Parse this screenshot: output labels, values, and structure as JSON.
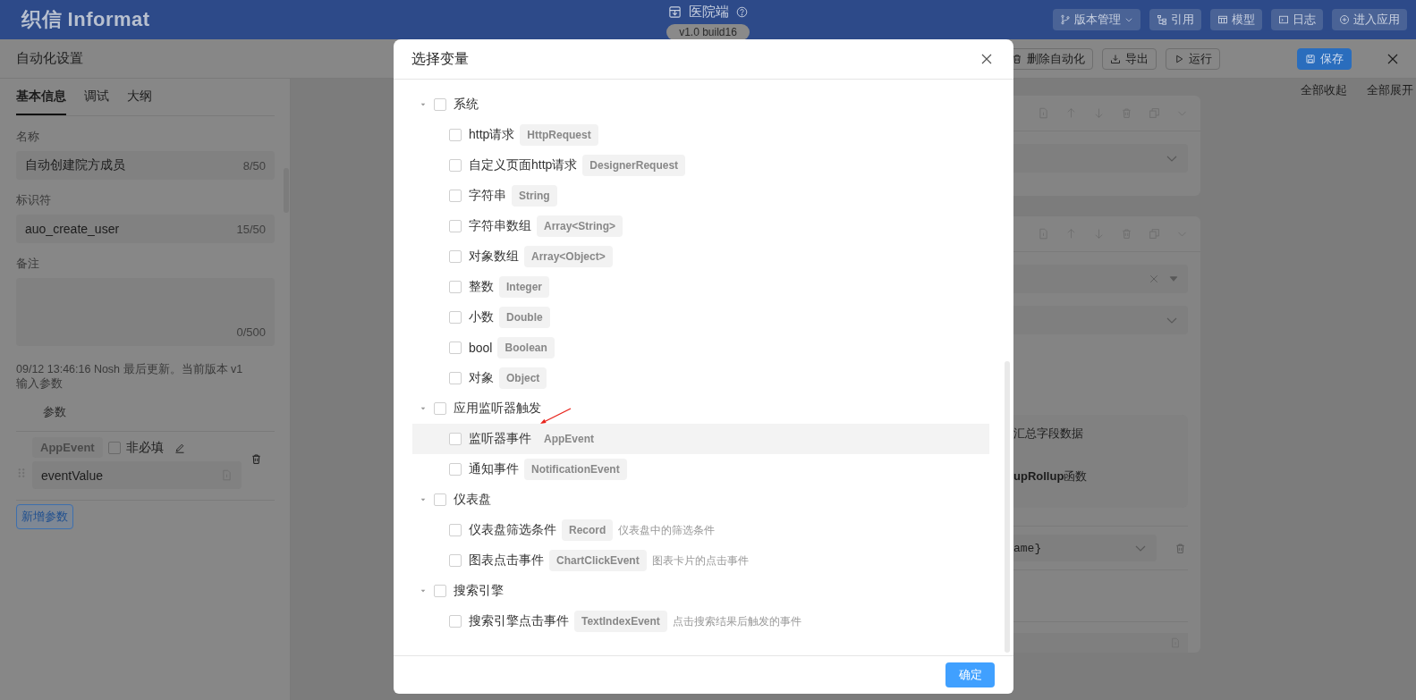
{
  "header": {
    "logo": "织信 Informat",
    "app_title": "医院端",
    "version": "v1.0 build16",
    "buttons": [
      {
        "label": "版本管理",
        "dropdown": true
      },
      {
        "label": "引用",
        "dropdown": false
      },
      {
        "label": "模型",
        "dropdown": false
      },
      {
        "label": "日志",
        "dropdown": false
      },
      {
        "label": "进入应用",
        "dropdown": false
      }
    ]
  },
  "drawer": {
    "title": "自动化设置",
    "actions": [
      {
        "label": "删除自动化",
        "primary": false
      },
      {
        "label": "导出",
        "primary": false
      },
      {
        "label": "运行",
        "primary": false
      },
      {
        "label": "保存",
        "primary": true
      }
    ]
  },
  "left_panel": {
    "tabs": [
      {
        "label": "基本信息",
        "selected": true
      },
      {
        "label": "调试",
        "selected": false
      },
      {
        "label": "大纲",
        "selected": false
      }
    ],
    "fields": [
      {
        "label": "名称",
        "kind": "input",
        "value": "自动创建院方成员",
        "count": "8/50"
      },
      {
        "label": "标识符",
        "kind": "input",
        "value": "auo_create_user",
        "count": "15/50"
      },
      {
        "label": "备注",
        "kind": "textarea",
        "count": "0/500"
      }
    ],
    "meta": "09/12 13:46:16 Nosh 最后更新。当前版本 v1",
    "params_title": "输入参数",
    "params_column": "参数",
    "params": [
      {
        "type": "AppEvent",
        "optional_label": "非必填",
        "optional": false,
        "name": "eventValue"
      }
    ],
    "add_button": "新增参数"
  },
  "canvas": {
    "collapse_all": "全部收起",
    "expand_all": "全部展开",
    "info_lines": [
      "汇总字段数据",
      "**upRollup**函数"
    ],
    "expression": "ame}"
  },
  "dialog": {
    "title": "选择变量",
    "confirm": "确定",
    "groups": [
      {
        "label": "系统",
        "expanded": true,
        "checked": false,
        "children": [
          {
            "label": "http请求",
            "type": "HttpRequest",
            "checked": false,
            "hovered": false,
            "annotated": false
          },
          {
            "label": "自定义页面http请求",
            "type": "DesignerRequest",
            "checked": false,
            "hovered": false,
            "annotated": false
          },
          {
            "label": "字符串",
            "type": "String",
            "checked": false,
            "hovered": false,
            "annotated": false
          },
          {
            "label": "字符串数组",
            "type": "Array<String>",
            "checked": false,
            "hovered": false,
            "annotated": false
          },
          {
            "label": "对象数组",
            "type": "Array<Object>",
            "checked": false,
            "hovered": false,
            "annotated": false
          },
          {
            "label": "整数",
            "type": "Integer",
            "checked": false,
            "hovered": false,
            "annotated": false
          },
          {
            "label": "小数",
            "type": "Double",
            "checked": false,
            "hovered": false,
            "annotated": false
          },
          {
            "label": "bool",
            "type": "Boolean",
            "checked": false,
            "hovered": false,
            "annotated": false
          },
          {
            "label": "对象",
            "type": "Object",
            "checked": false,
            "hovered": false,
            "annotated": false
          }
        ]
      },
      {
        "label": "应用监听器触发",
        "expanded": true,
        "checked": false,
        "children": [
          {
            "label": "监听器事件",
            "type": "AppEvent",
            "checked": false,
            "hovered": true,
            "annotated": true
          },
          {
            "label": "通知事件",
            "type": "NotificationEvent",
            "checked": false,
            "hovered": false,
            "annotated": false
          }
        ]
      },
      {
        "label": "仪表盘",
        "expanded": true,
        "checked": false,
        "children": [
          {
            "label": "仪表盘筛选条件",
            "type": "Record",
            "description": "仪表盘中的筛选条件",
            "checked": false,
            "hovered": false,
            "annotated": false
          },
          {
            "label": "图表点击事件",
            "type": "ChartClickEvent",
            "description": "图表卡片的点击事件",
            "checked": false,
            "hovered": false,
            "annotated": false
          }
        ]
      },
      {
        "label": "搜索引擎",
        "expanded": true,
        "checked": false,
        "children": [
          {
            "label": "搜索引擎点击事件",
            "type": "TextIndexEvent",
            "description": "点击搜索结果后触发的事件",
            "checked": false,
            "hovered": false,
            "annotated": false
          }
        ]
      }
    ]
  }
}
